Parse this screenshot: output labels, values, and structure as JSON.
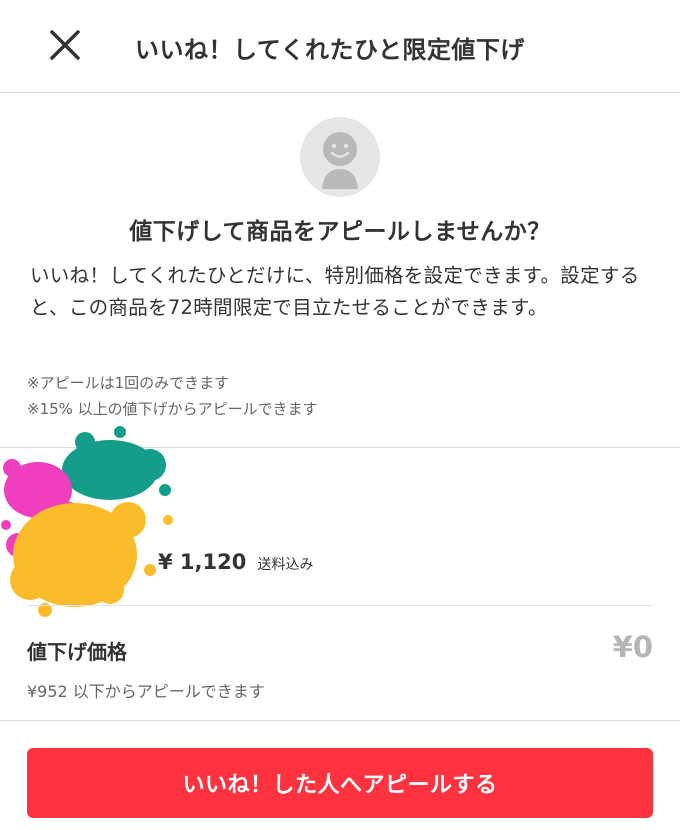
{
  "header": {
    "title": "いいね！してくれたひと限定値下げ",
    "close_icon": "close-icon"
  },
  "intro": {
    "heading": "値下げして商品をアピールしませんか？",
    "description": "いいね！してくれたひとだけに、特別価格を設定できます。設定すると、この商品を72時間限定で目立たせることができます。",
    "notes": [
      "※アピールは1回のみできます",
      "※15% 以上の値下げからアピールできます"
    ]
  },
  "product": {
    "price": "¥ 1,120",
    "shipping": "送料込み"
  },
  "discount": {
    "label": "値下げ価格",
    "value": "¥0",
    "hint": "¥952 以下からアピールできます"
  },
  "cta": {
    "label": "いいね！した人へアピールする"
  },
  "colors": {
    "accent": "#ff333f",
    "text": "#333333",
    "muted": "#666666",
    "placeholder": "#b5b5b5"
  }
}
